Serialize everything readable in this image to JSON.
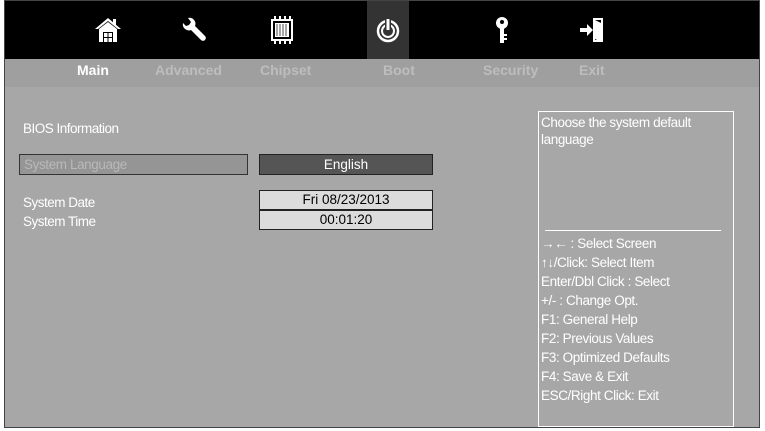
{
  "icons": [
    {
      "name": "home-icon",
      "active": false
    },
    {
      "name": "wrench-icon",
      "active": false
    },
    {
      "name": "chip-icon",
      "active": false
    },
    {
      "name": "power-icon",
      "active": true
    },
    {
      "name": "key-icon",
      "active": false
    },
    {
      "name": "exit-icon",
      "active": false
    }
  ],
  "tabs": [
    "Main",
    "Advanced",
    "Chipset",
    "Boot",
    "Security",
    "Exit"
  ],
  "active_tab": "Main",
  "main": {
    "bios_info": "BIOS Information",
    "language_label": "System Language",
    "language_value": "English",
    "date_label": "System Date",
    "date_value": "Fri 08/23/2013",
    "time_label": "System Time",
    "time_value": "00:01:20"
  },
  "help": {
    "description": "Choose the system default language",
    "keys": [
      "→← : Select Screen",
      "↑↓/Click: Select Item",
      "Enter/Dbl Click : Select",
      "+/- : Change Opt.",
      "F1: General Help",
      "F2: Previous Values",
      "F3: Optimized Defaults",
      "F4: Save & Exit",
      "ESC/Right Click: Exit"
    ]
  },
  "colors": {
    "background": "#a7a7a7",
    "icon_bar": "#000000",
    "field_dark": "#555555",
    "field_light": "#dcdcdc",
    "text": "#ffffff"
  }
}
